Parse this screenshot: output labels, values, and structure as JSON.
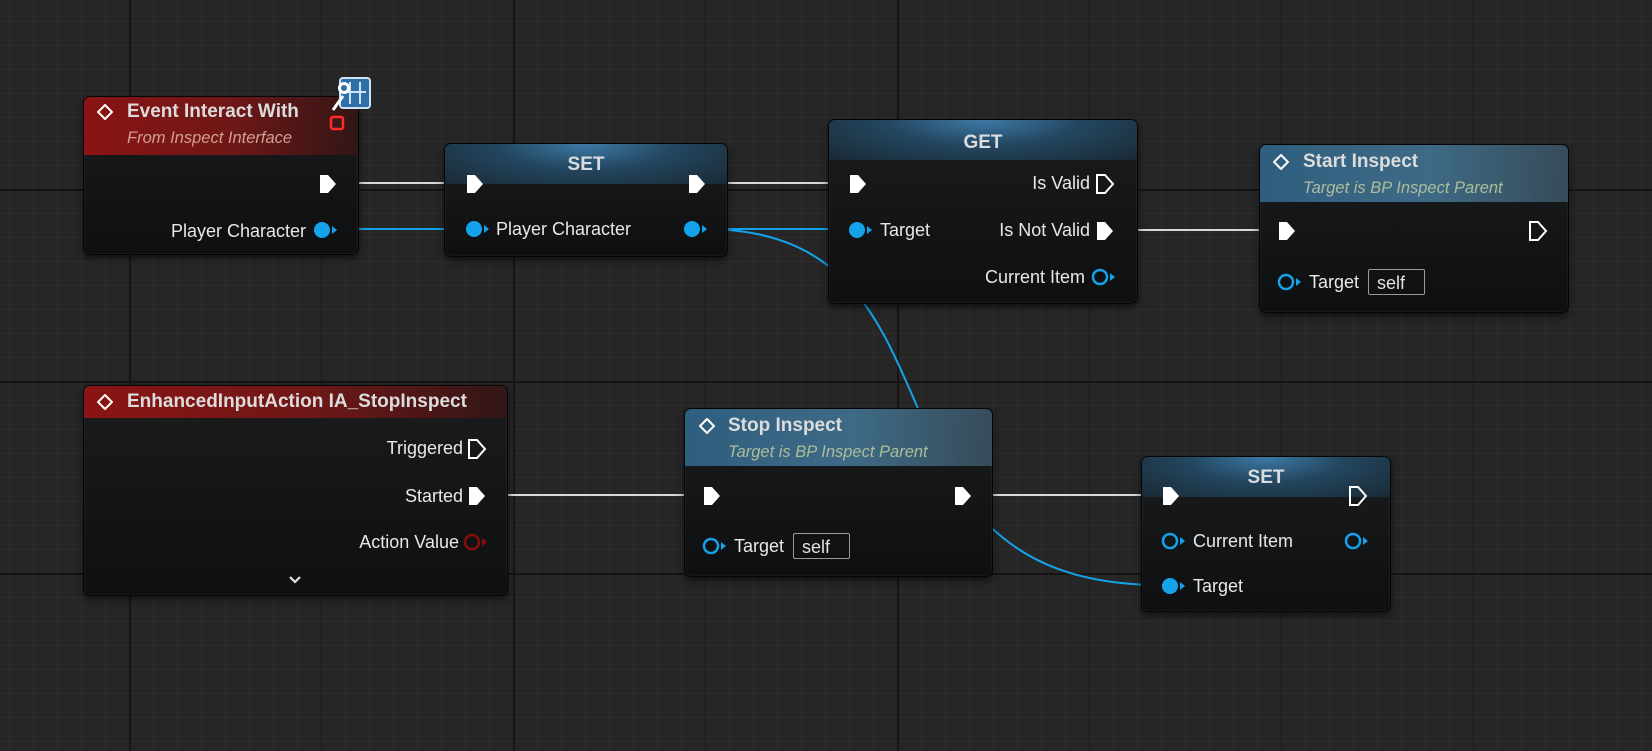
{
  "colors": {
    "exec": "#ffffff",
    "object_pin": "#14a3ea",
    "struct_pin": "#8a0c0c",
    "event_header": "#8b1414",
    "function_header": "#2f5e7e",
    "variable_header": "#3d7aa6"
  },
  "nodes": {
    "event_interact": {
      "title": "Event Interact With",
      "subtitle": "From Inspect Interface",
      "icon": "event-diamond-icon",
      "badge_icon": "interface-badge-icon",
      "output_label": "Player Character"
    },
    "set_player": {
      "title": "SET",
      "input_label": "Player Character"
    },
    "get_item": {
      "title": "GET",
      "target_label": "Target",
      "is_valid": "Is Valid",
      "is_not_valid": "Is Not Valid",
      "current_item": "Current Item"
    },
    "start_inspect": {
      "title": "Start Inspect",
      "subtitle": "Target is BP Inspect Parent",
      "target_label": "Target",
      "target_value": "self"
    },
    "input_action": {
      "title": "EnhancedInputAction IA_StopInspect",
      "triggered": "Triggered",
      "started": "Started",
      "action_value": "Action Value",
      "expand_icon": "chevron-down-icon"
    },
    "stop_inspect": {
      "title": "Stop Inspect",
      "subtitle": "Target is BP Inspect Parent",
      "target_label": "Target",
      "target_value": "self"
    },
    "set_item": {
      "title": "SET",
      "current_item": "Current Item",
      "target_label": "Target"
    }
  }
}
